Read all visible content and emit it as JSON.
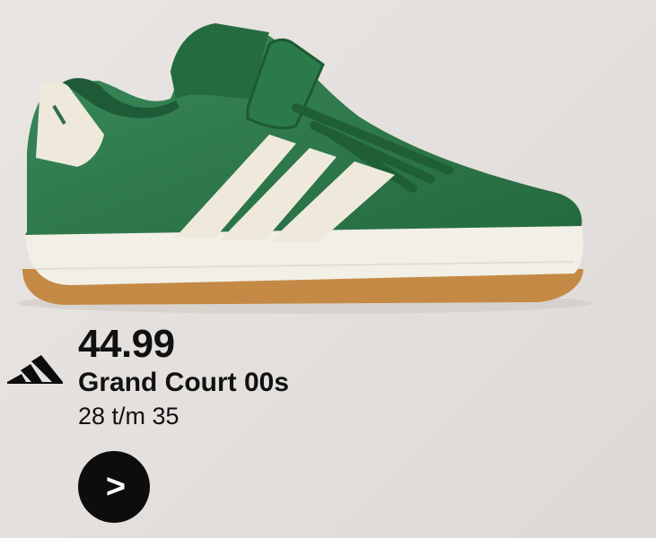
{
  "product": {
    "price": "44.99",
    "name": "Grand Court 00s",
    "sizes": "28 t/m 35",
    "cta_label": ">",
    "image_icon": "green-suede-sneaker-image"
  },
  "brand": {
    "logo_icon": "adidas-logo-icon"
  },
  "colors": {
    "suede_green": "#2f7d4f",
    "stripe_cream": "#efe9dc",
    "sole_cream": "#f2efe6",
    "gum": "#c48a45",
    "text": "#111111",
    "button": "#0d0d0d"
  }
}
